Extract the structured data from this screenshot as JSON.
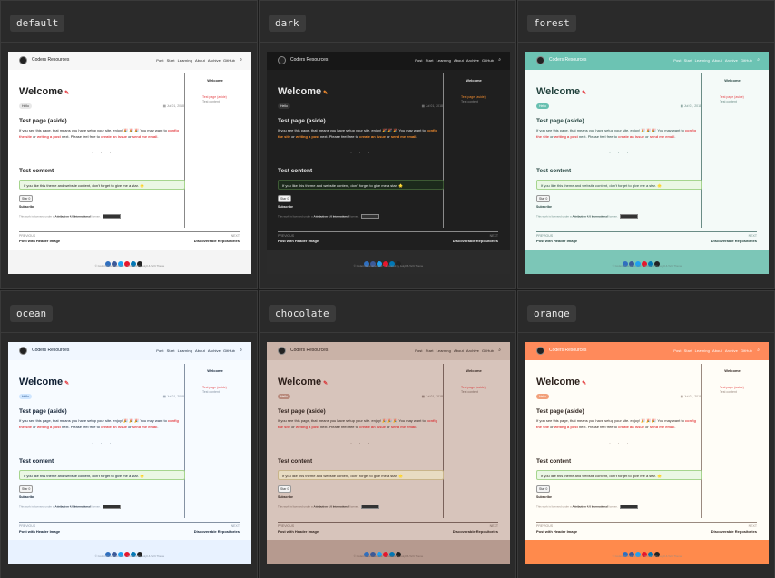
{
  "page": {
    "site_brand": "Coders Resources",
    "nav_links": [
      "Post",
      "Start",
      "Learning",
      "About",
      "Archive",
      "GitHub"
    ],
    "search_icon": "search-icon",
    "title": "Welcome",
    "tag": "Hello",
    "date": "Jul 01, 2018",
    "aside_heading": "Test page (aside)",
    "para_intro": "If you see this page, that means you have setup your site. enjoy! 🎉 🎉 🎉 You may want to",
    "para_link1": "config the site",
    "para_or1": "or",
    "para_link2": "writing a post",
    "para_next": "next. Please feel free to",
    "para_link3": "create an issue",
    "para_or2": "or",
    "para_link4": "send me email",
    "para_end": ".",
    "dots": "· · ·",
    "content_heading": "Test content",
    "note": "If you like this theme and website content, don't forget to give me a star. 🌟",
    "star_button": "Star 0",
    "subscribe": "Subscribe",
    "license_text": "This work is licensed under a",
    "license_link": "Attribution 4.0 International",
    "license_suffix": "license.",
    "sidebar_title": "Welcome",
    "sidebar_link1": "Test page (aside)",
    "sidebar_link2": "Test content",
    "previous_label": "PREVIOUS",
    "previous_post": "Post with Header Image",
    "next_label": "NEXT",
    "next_post": "Discoverable Repositories",
    "copyright": "© Coders Resources 2017 · Powered by Jekyll & TeXt Theme",
    "social_icons": [
      "email-icon",
      "facebook-icon",
      "twitter-icon",
      "weibo-icon",
      "linkedin-icon",
      "github-icon"
    ]
  },
  "themes": [
    {
      "name": "default",
      "bg": "#ffffff",
      "nav_bg": "#f7f7f7",
      "text": "#222222",
      "muted": "#888888",
      "link": "#e5484d",
      "accent": "#1c7ed6",
      "footer_bg": "#f4f4f4",
      "note_bg": "#eaf7e4",
      "note_border": "#a6d58e",
      "tag_bg": "#e8e8e8",
      "tag_text": "#333333",
      "side_text": "#222222"
    },
    {
      "name": "dark",
      "bg": "#1f1f1f",
      "nav_bg": "#171717",
      "text": "#e8e8e8",
      "muted": "#8a8a8a",
      "link": "#ef8a2e",
      "accent": "#2f7fc8",
      "footer_bg": "#2b2b2b",
      "note_bg": "#1c2a1c",
      "note_border": "#3d5a34",
      "tag_bg": "#333333",
      "tag_text": "#e8e8e8",
      "side_text": "#e8e8e8"
    },
    {
      "name": "forest",
      "bg": "#f4faf8",
      "nav_bg": "#6cc3b3",
      "text": "#1f3f3a",
      "muted": "#6a8c86",
      "link": "#e5484d",
      "accent": "#3d8bbd",
      "footer_bg": "#7cc6b7",
      "note_bg": "#eaf7e4",
      "note_border": "#a6d58e",
      "tag_bg": "#68c0b0",
      "tag_text": "#ffffff",
      "side_text": "#1f3f3a"
    },
    {
      "name": "ocean",
      "bg": "#f7fbff",
      "nav_bg": "#f1f7ff",
      "text": "#0f1f33",
      "muted": "#8592a3",
      "link": "#e5484d",
      "accent": "#1d6fe0",
      "footer_bg": "#e8f2ff",
      "note_bg": "#eaf7e4",
      "note_border": "#a6d58e",
      "tag_bg": "#cfe6ff",
      "tag_text": "#1d4e89",
      "side_text": "#0f1f33"
    },
    {
      "name": "chocolate",
      "bg": "#d7c4bb",
      "nav_bg": "#c9b2a7",
      "text": "#2d1f1a",
      "muted": "#7a625a",
      "link": "#d83f41",
      "accent": "#2c6aa8",
      "footer_bg": "#b69a8f",
      "note_bg": "#e8dcc2",
      "note_border": "#c9b58a",
      "tag_bg": "#b88a7c",
      "tag_text": "#ffffff",
      "side_text": "#2d1f1a"
    },
    {
      "name": "orange",
      "bg": "#fffdf7",
      "nav_bg": "#ff8a5b",
      "text": "#2a1f1a",
      "muted": "#9a8a80",
      "link": "#e54848",
      "accent": "#2e6cc4",
      "footer_bg": "#ff8a4c",
      "note_bg": "#eaf7e4",
      "note_border": "#a6d58e",
      "tag_bg": "#f2a07a",
      "tag_text": "#ffffff",
      "side_text": "#2a1f1a"
    }
  ],
  "social_colors": [
    "#2f6fbf",
    "#3b5998",
    "#1da1f2",
    "#e6162d",
    "#0077b5",
    "#222222"
  ]
}
